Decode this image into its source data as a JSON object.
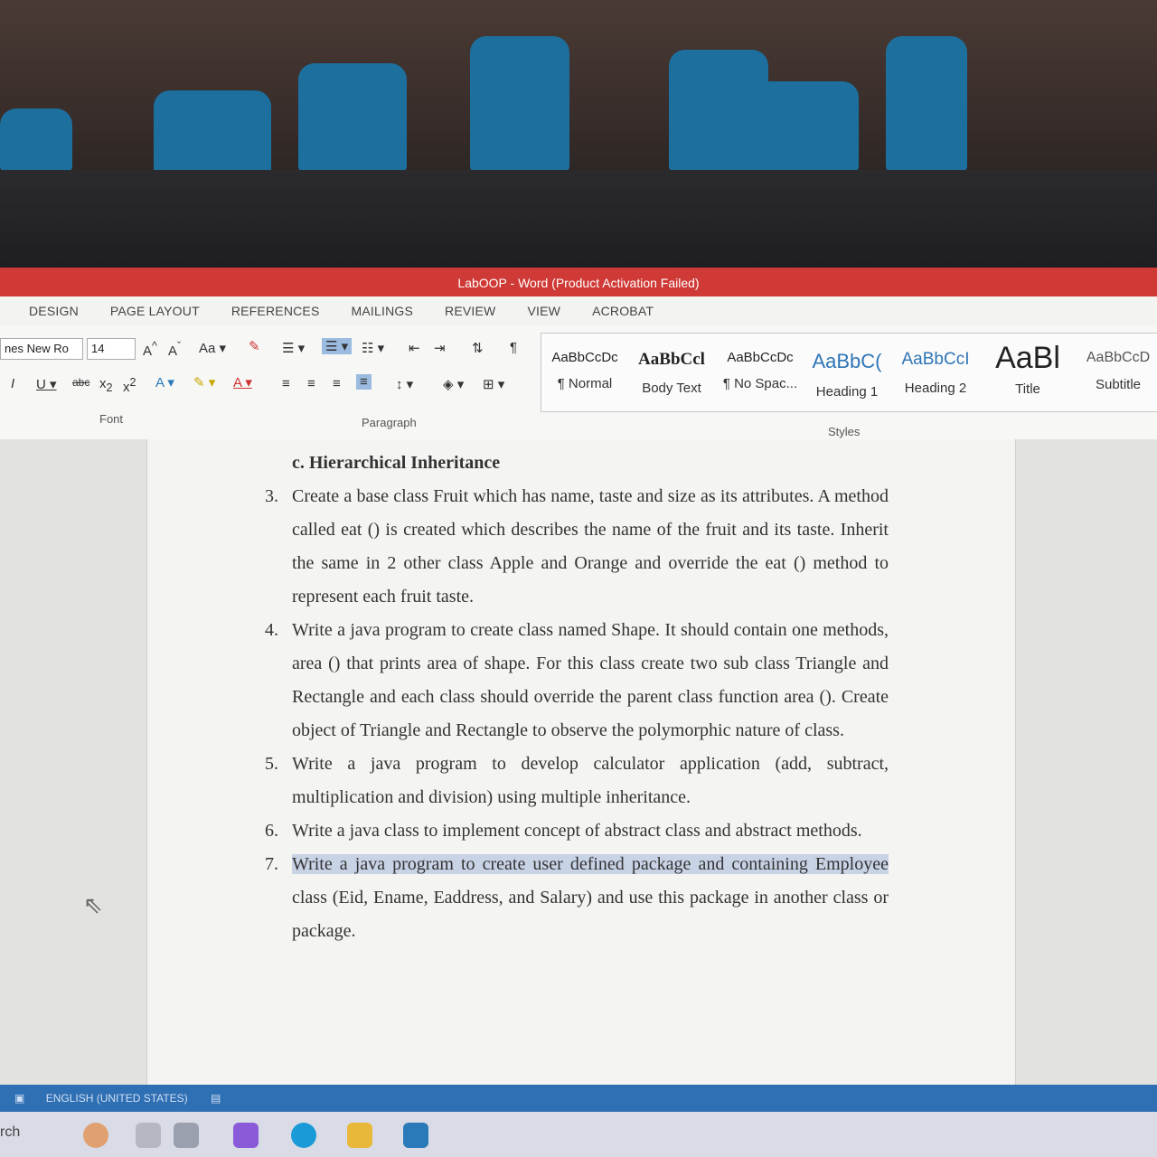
{
  "window": {
    "title": "LabOOP - Word (Product Activation Failed)"
  },
  "ribbon_tabs": [
    "DESIGN",
    "PAGE LAYOUT",
    "REFERENCES",
    "MAILINGS",
    "REVIEW",
    "VIEW",
    "ACROBAT"
  ],
  "font": {
    "name": "nes New Ro",
    "size": "14",
    "group_label": "Font"
  },
  "paragraph": {
    "group_label": "Paragraph"
  },
  "styles": {
    "group_label": "Styles",
    "items": [
      {
        "sample": "AaBbCcDc",
        "label": "¶ Normal"
      },
      {
        "sample": "AaBbCcl",
        "label": "Body Text"
      },
      {
        "sample": "AaBbCcDc",
        "label": "¶ No Spac..."
      },
      {
        "sample": "AaBbC(",
        "label": "Heading 1"
      },
      {
        "sample": "AaBbCcI",
        "label": "Heading 2"
      },
      {
        "sample": "AaBl",
        "label": "Title"
      },
      {
        "sample": "AaBbCcD",
        "label": "Subtitle"
      }
    ]
  },
  "document": {
    "heading": "c.  Hierarchical Inheritance",
    "items": [
      {
        "num": "3.",
        "text": "Create a base class Fruit which has name, taste and size as its attributes. A method called eat () is created which describes the name of the fruit and its taste. Inherit the same in 2 other class Apple and Orange and override the eat () method to represent each fruit taste."
      },
      {
        "num": "4.",
        "text": "Write a java program to create class named Shape. It should contain one methods, area () that prints area of shape. For this class create two sub class Triangle and Rectangle and each class should override the parent class function area (). Create object of Triangle and Rectangle to observe the polymorphic nature of class."
      },
      {
        "num": "5.",
        "text": "Write a java program to develop calculator application (add, subtract, multiplication and division) using multiple inheritance."
      },
      {
        "num": "6.",
        "text": "Write a java class to implement concept of abstract class and abstract methods."
      },
      {
        "num": "7.",
        "text_highlight": "Write a java program to create user defined package and containing Employee",
        "text": "class (Eid, Ename, Eaddress, and Salary) and use this package in another class or package."
      }
    ]
  },
  "statusbar": {
    "language": "ENGLISH (UNITED STATES)"
  },
  "taskbar": {
    "search_fragment": "rch"
  }
}
